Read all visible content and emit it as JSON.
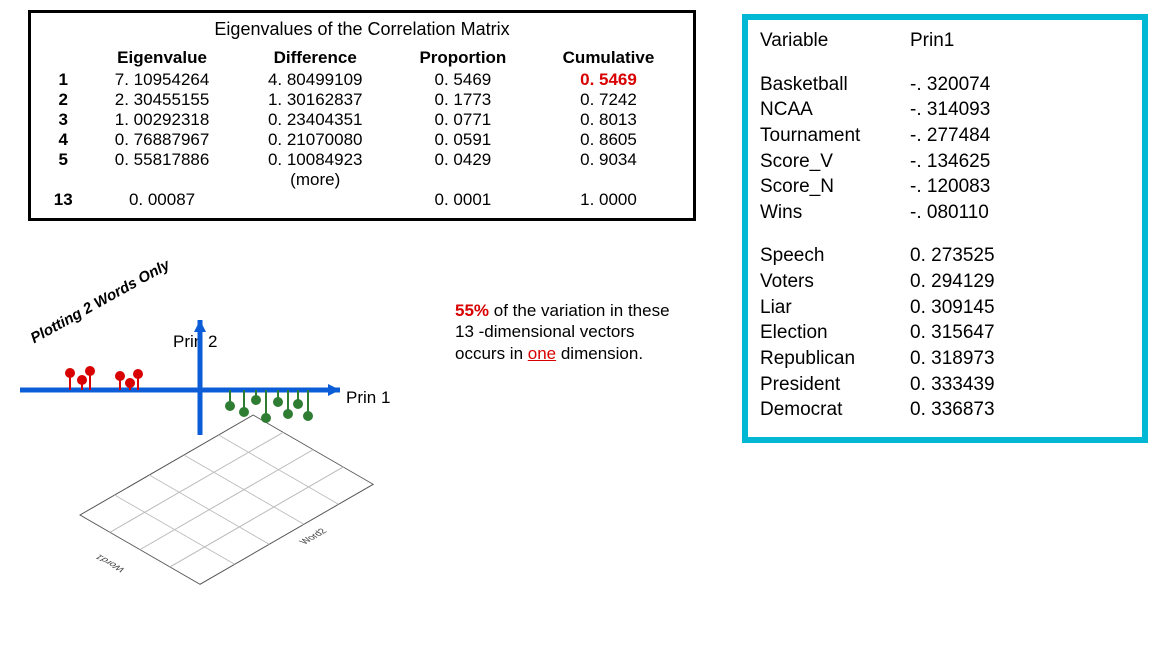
{
  "colors": {
    "accent_red": "#d80000",
    "teal": "#00b8d4"
  },
  "eig": {
    "title": "Eigenvalues of the Correlation Matrix",
    "headers": {
      "idx": "",
      "eig": "Eigenvalue",
      "diff": "Difference",
      "prop": "Proportion",
      "cum": "Cumulative"
    },
    "rows": [
      {
        "idx": "1",
        "eig": "7. 10954264",
        "diff": "4. 80499109",
        "prop": "0. 5469",
        "cum": "0. 5469"
      },
      {
        "idx": "2",
        "eig": "2. 30455155",
        "diff": "1. 30162837",
        "prop": "0. 1773",
        "cum": "0. 7242"
      },
      {
        "idx": "3",
        "eig": "1. 00292318",
        "diff": "0. 23404351",
        "prop": "0. 0771",
        "cum": "0. 8013"
      },
      {
        "idx": "4",
        "eig": "0. 76887967",
        "diff": "0. 21070080",
        "prop": "0. 0591",
        "cum": "0. 8605"
      },
      {
        "idx": "5",
        "eig": "0. 55817886",
        "diff": "0. 10084923",
        "prop": "0. 0429",
        "cum": "0. 9034"
      }
    ],
    "more": "(more)",
    "last": {
      "idx": "13",
      "eig": "0. 00087",
      "diff": "",
      "prop": "0. 0001",
      "cum": "1. 0000"
    }
  },
  "caption": {
    "pct": "55%",
    "rest1": " of the variation in these 13 -dimensional vectors occurs in ",
    "one": "one",
    "rest2": " dimension."
  },
  "diag_label": "Plotting 2 Words Only",
  "axis": {
    "prin1": "Prin 1",
    "prin2": "Prin 2",
    "word1": "Word1",
    "word2": "Word2"
  },
  "chart_data": {
    "type": "scatter",
    "title": "Plotting 2 Words Only",
    "xlabel": "Word2",
    "ylabel": "Word1",
    "xlim": [
      -2,
      22
    ],
    "ylim": [
      -2,
      22
    ],
    "x_ticks": [
      -2,
      -1,
      1,
      2,
      3,
      4,
      5,
      6,
      7,
      8,
      10,
      12,
      14,
      16,
      18,
      20,
      22
    ],
    "y_ticks": [
      -22,
      -20,
      -18,
      -16,
      -14,
      -12,
      -10,
      -9,
      -8,
      -2
    ],
    "series": [
      {
        "name": "red",
        "color": "#d80000",
        "points": [
          {
            "x": -1.5,
            "y": -8
          },
          {
            "x": -1.0,
            "y": -8.5
          },
          {
            "x": -0.7,
            "y": -7.8
          },
          {
            "x": 1.2,
            "y": -8.2
          },
          {
            "x": 1.6,
            "y": -9
          },
          {
            "x": 2.0,
            "y": -8.4
          }
        ]
      },
      {
        "name": "green",
        "color": "#2e7d32",
        "points": [
          {
            "x": 8,
            "y": -8
          },
          {
            "x": 10,
            "y": -8.5
          },
          {
            "x": 12,
            "y": -7.6
          },
          {
            "x": 13,
            "y": -9.2
          },
          {
            "x": 14,
            "y": -7.9
          },
          {
            "x": 15,
            "y": -8.8
          },
          {
            "x": 16,
            "y": -8.1
          },
          {
            "x": 17,
            "y": -9.1
          }
        ]
      }
    ],
    "prin_axes": [
      {
        "name": "Prin 1",
        "dir": "horizontal"
      },
      {
        "name": "Prin 2",
        "dir": "vertical"
      }
    ]
  },
  "vars": {
    "header": {
      "var": "Variable",
      "p1": "Prin1"
    },
    "groups": [
      [
        {
          "nm": "Basketball",
          "val": "-. 320074"
        },
        {
          "nm": "NCAA",
          "val": "-. 314093"
        },
        {
          "nm": "Tournament",
          "val": "-. 277484"
        },
        {
          "nm": "Score_V",
          "val": "-. 134625"
        },
        {
          "nm": "Score_N",
          "val": "-. 120083"
        },
        {
          "nm": "Wins",
          "val": "-. 080110"
        }
      ],
      [
        {
          "nm": "Speech",
          "val": "0. 273525"
        },
        {
          "nm": "Voters",
          "val": "0. 294129"
        },
        {
          "nm": "Liar",
          "val": "0. 309145"
        },
        {
          "nm": "Election",
          "val": "0. 315647"
        },
        {
          "nm": "Republican",
          "val": "0. 318973"
        },
        {
          "nm": "President",
          "val": "0. 333439"
        },
        {
          "nm": "Democrat",
          "val": "0. 336873"
        }
      ]
    ]
  }
}
